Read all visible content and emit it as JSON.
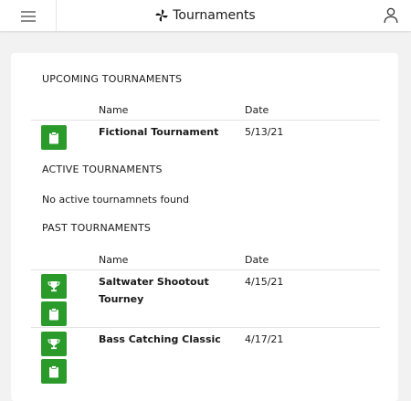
{
  "header": {
    "title": "Tournaments",
    "menu_icon": "hamburger-menu-icon",
    "title_icon": "pinwheel-icon",
    "user_icon": "user-icon"
  },
  "upcoming": {
    "heading": "UPCOMING TOURNAMENTS",
    "col_name": "Name",
    "col_date": "Date",
    "rows": [
      {
        "name": "Fictional Tournament",
        "date": "5/13/21",
        "actions": [
          "clipboard-icon"
        ]
      }
    ]
  },
  "active": {
    "heading": "ACTIVE TOURNAMENTS",
    "empty_message": "No active tournamnets found"
  },
  "past": {
    "heading": "PAST TOURNAMENTS",
    "col_name": "Name",
    "col_date": "Date",
    "rows": [
      {
        "name_line1": "Saltwater Shootout",
        "name_line2": "Tourney",
        "date": "4/15/21",
        "actions": [
          "trophy-icon",
          "clipboard-icon"
        ]
      },
      {
        "name": "Bass Catching Classic",
        "date": "4/17/21",
        "actions": [
          "trophy-icon",
          "clipboard-icon"
        ]
      }
    ]
  },
  "colors": {
    "accent_green": "#2a9b2a",
    "page_bg": "#f2f2f2",
    "card_bg": "#ffffff"
  }
}
